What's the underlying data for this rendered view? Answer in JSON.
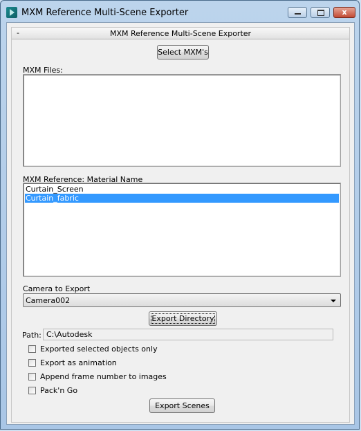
{
  "window": {
    "title": "MXM Reference Multi-Scene Exporter",
    "controls": {
      "minimize_icon": "minimize-icon",
      "maximize_icon": "maximize-icon",
      "close_label": "x"
    }
  },
  "rollout": {
    "collapse_symbol": "-",
    "title": "MXM Reference Multi-Scene Exporter"
  },
  "buttons": {
    "select_mxms": "Select MXM's",
    "export_directory": "Export Directory",
    "export_scenes": "Export Scenes"
  },
  "mxm_files": {
    "label": "MXM Files:",
    "items": []
  },
  "material_list": {
    "label": "MXM Reference: Material Name",
    "items": [
      "Curtain_Screen",
      "Curtain_fabric"
    ],
    "selected_index": 1
  },
  "camera": {
    "label": "Camera to Export",
    "selected": "Camera002"
  },
  "path": {
    "label": "Path:",
    "value": "C:\\Autodesk"
  },
  "options": [
    {
      "label": "Exported selected objects only",
      "checked": false
    },
    {
      "label": "Export as animation",
      "checked": false
    },
    {
      "label": "Append frame number to images",
      "checked": false
    },
    {
      "label": "Pack'n Go",
      "checked": false
    }
  ],
  "colors": {
    "selection": "#3399ff",
    "close_button": "#c24a33"
  }
}
